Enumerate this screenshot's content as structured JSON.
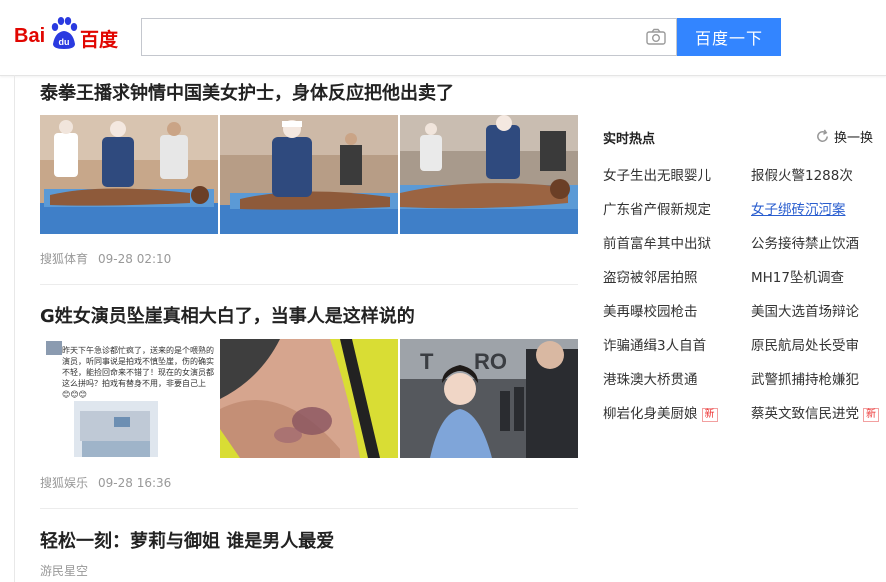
{
  "header": {
    "logo_text_left": "Bai",
    "logo_text_mid": "du",
    "logo_text_right": "百度",
    "search_value": "",
    "search_button": "百度一下"
  },
  "articles": [
    {
      "title": "泰拳王播求钟情中国美女护士，身体反应把他出卖了",
      "source": "搜狐体育",
      "time": "09-28 02:10"
    },
    {
      "title": "G姓女演员坠崖真相大白了，当事人是这样说的",
      "source": "搜狐娱乐",
      "time": "09-28 16:36",
      "thumb1_text": "昨天下午急诊都忙疯了，送来的是个喂熟的演员，听同事说是拍戏不慎坠崖，伤的确实不轻，能捡回命来不错了！现在的女演员都这么拼吗？拍戏有替身不用，非要自己上😊😊😊"
    },
    {
      "title": "轻松一刻：萝莉与御姐 谁是男人最爱",
      "source": "游民星空"
    }
  ],
  "hot": {
    "title": "实时热点",
    "refresh_label": "换一换",
    "new_label": "新",
    "items": [
      [
        "女子生出无眼婴儿",
        "报假火警1288次"
      ],
      [
        "广东省产假新规定",
        "女子绑砖沉河案"
      ],
      [
        "前首富牟其中出狱",
        "公务接待禁止饮酒"
      ],
      [
        "盗窃被邻居拍照",
        "MH17坠机调查"
      ],
      [
        "美再曝校园枪击",
        "美国大选首场辩论"
      ],
      [
        "诈骗通缉3人自首",
        "原民航局处长受审"
      ],
      [
        "港珠澳大桥贯通",
        "武警抓捕持枪嫌犯"
      ],
      [
        "柳岩化身美厨娘",
        "蔡英文致信民进党"
      ]
    ]
  }
}
